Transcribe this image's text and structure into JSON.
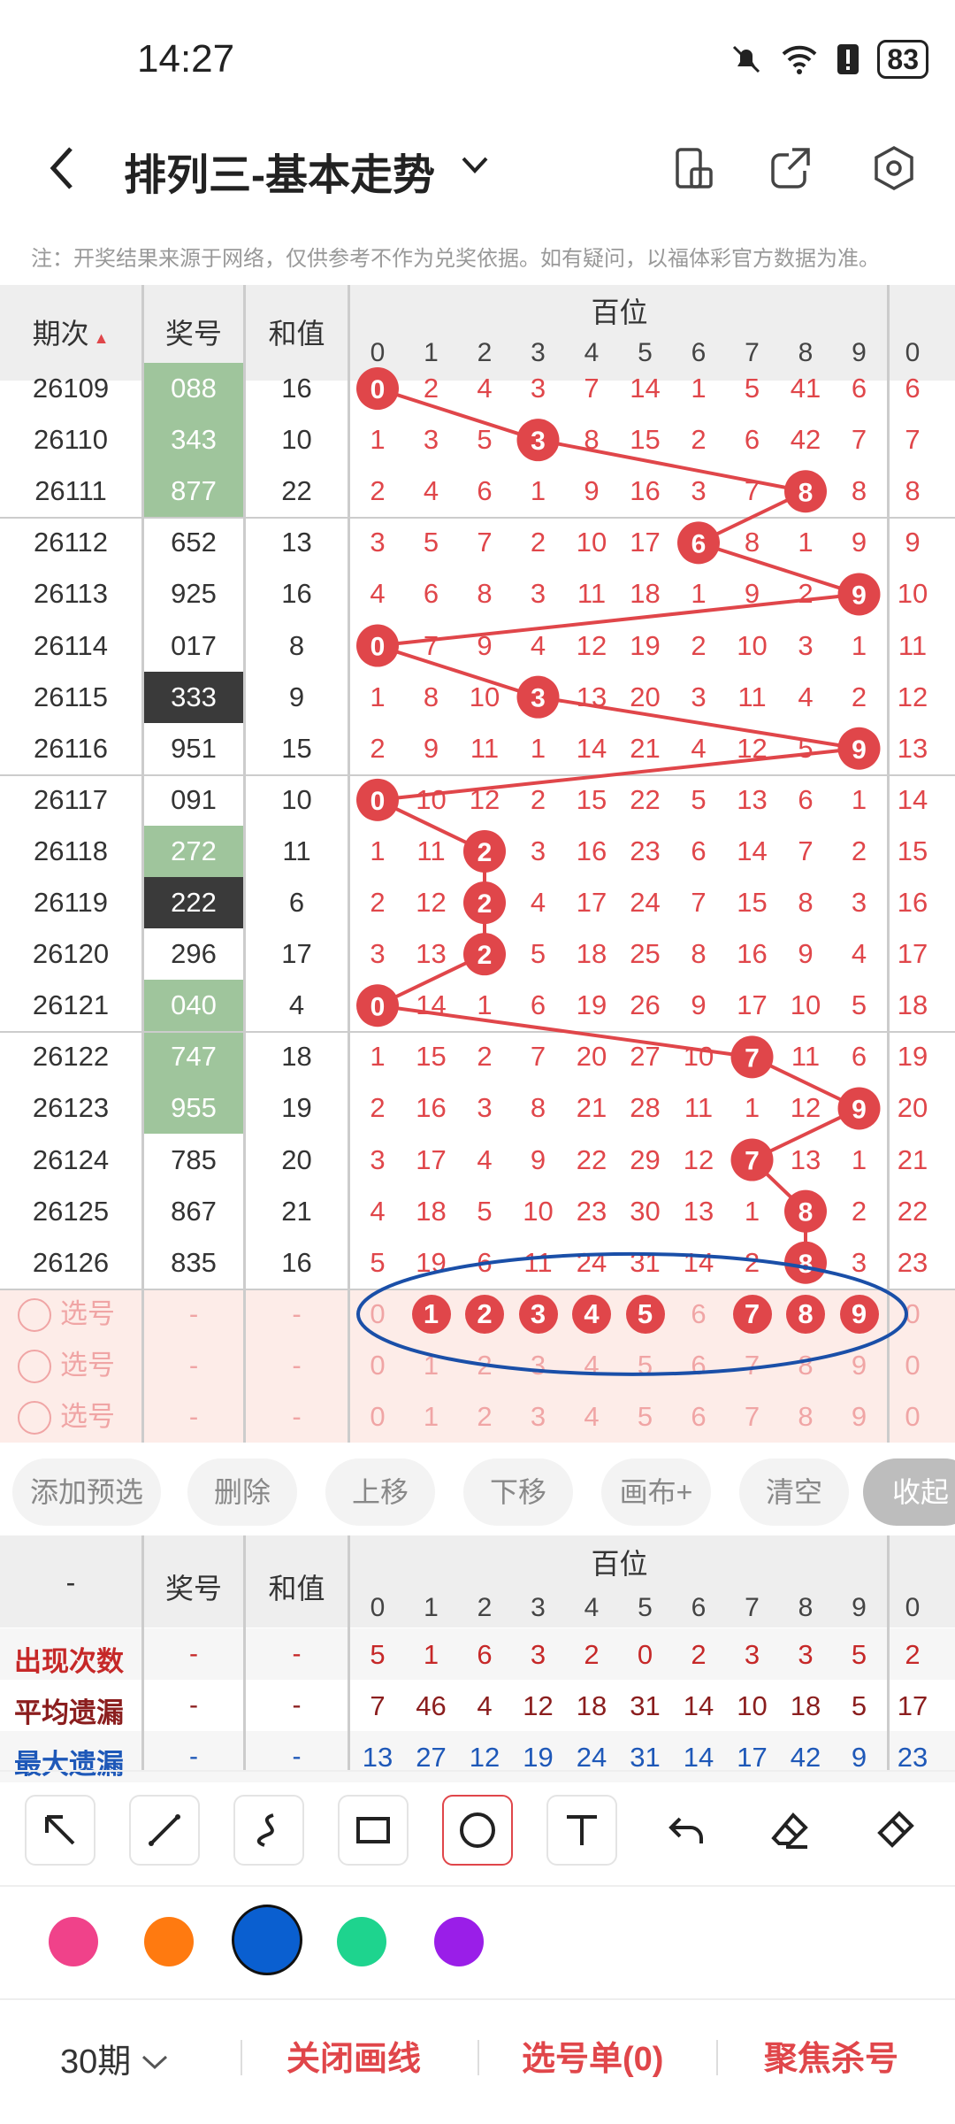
{
  "status": {
    "time": "14:27",
    "battery": "83"
  },
  "header": {
    "title": "排列三-基本走势"
  },
  "note": "注：开奖结果来源于网络，仅供参考不作为兑奖依据。如有疑问，以福体彩官方数据为准。",
  "table": {
    "col_issue": "期次",
    "col_award": "奖号",
    "col_sum": "和值",
    "col_hundreds": "百位",
    "digits": [
      "0",
      "1",
      "2",
      "3",
      "4",
      "5",
      "6",
      "7",
      "8",
      "9",
      "0"
    ],
    "rows": [
      {
        "issue": "26109",
        "award": "088",
        "sum": "16",
        "cells": [
          "0",
          "2",
          "4",
          "3",
          "7",
          "14",
          "1",
          "5",
          "41",
          "6",
          "6"
        ]
      },
      {
        "issue": "26110",
        "award": "343",
        "sum": "10",
        "cells": [
          "1",
          "3",
          "5",
          "3",
          "8",
          "15",
          "2",
          "6",
          "42",
          "7",
          "7"
        ]
      },
      {
        "issue": "26111",
        "award": "877",
        "sum": "22",
        "cells": [
          "2",
          "4",
          "6",
          "1",
          "9",
          "16",
          "3",
          "7",
          "8",
          "8",
          "8"
        ]
      },
      {
        "issue": "26112",
        "award": "652",
        "sum": "13",
        "cells": [
          "3",
          "5",
          "7",
          "2",
          "10",
          "17",
          "6",
          "8",
          "1",
          "9",
          "9"
        ]
      },
      {
        "issue": "26113",
        "award": "925",
        "sum": "16",
        "cells": [
          "4",
          "6",
          "8",
          "3",
          "11",
          "18",
          "1",
          "9",
          "2",
          "9",
          "10"
        ]
      },
      {
        "issue": "26114",
        "award": "017",
        "sum": "8",
        "cells": [
          "0",
          "7",
          "9",
          "4",
          "12",
          "19",
          "2",
          "10",
          "3",
          "1",
          "11"
        ]
      },
      {
        "issue": "26115",
        "award": "333",
        "sum": "9",
        "cells": [
          "1",
          "8",
          "10",
          "3",
          "13",
          "20",
          "3",
          "11",
          "4",
          "2",
          "12"
        ]
      },
      {
        "issue": "26116",
        "award": "951",
        "sum": "15",
        "cells": [
          "2",
          "9",
          "11",
          "1",
          "14",
          "21",
          "4",
          "12",
          "5",
          "9",
          "13"
        ]
      },
      {
        "issue": "26117",
        "award": "091",
        "sum": "10",
        "cells": [
          "0",
          "10",
          "12",
          "2",
          "15",
          "22",
          "5",
          "13",
          "6",
          "1",
          "14"
        ]
      },
      {
        "issue": "26118",
        "award": "272",
        "sum": "11",
        "cells": [
          "1",
          "11",
          "2",
          "3",
          "16",
          "23",
          "6",
          "14",
          "7",
          "2",
          "15"
        ]
      },
      {
        "issue": "26119",
        "award": "222",
        "sum": "6",
        "cells": [
          "2",
          "12",
          "2",
          "4",
          "17",
          "24",
          "7",
          "15",
          "8",
          "3",
          "16"
        ]
      },
      {
        "issue": "26120",
        "award": "296",
        "sum": "17",
        "cells": [
          "3",
          "13",
          "2",
          "5",
          "18",
          "25",
          "8",
          "16",
          "9",
          "4",
          "17"
        ]
      },
      {
        "issue": "26121",
        "award": "040",
        "sum": "4",
        "cells": [
          "0",
          "14",
          "1",
          "6",
          "19",
          "26",
          "9",
          "17",
          "10",
          "5",
          "18"
        ]
      },
      {
        "issue": "26122",
        "award": "747",
        "sum": "18",
        "cells": [
          "1",
          "15",
          "2",
          "7",
          "20",
          "27",
          "10",
          "7",
          "11",
          "6",
          "19"
        ]
      },
      {
        "issue": "26123",
        "award": "955",
        "sum": "19",
        "cells": [
          "2",
          "16",
          "3",
          "8",
          "21",
          "28",
          "11",
          "1",
          "12",
          "9",
          "20"
        ]
      },
      {
        "issue": "26124",
        "award": "785",
        "sum": "20",
        "cells": [
          "3",
          "17",
          "4",
          "9",
          "22",
          "29",
          "12",
          "7",
          "13",
          "1",
          "21"
        ]
      },
      {
        "issue": "26125",
        "award": "867",
        "sum": "21",
        "cells": [
          "4",
          "18",
          "5",
          "10",
          "23",
          "30",
          "13",
          "1",
          "8",
          "2",
          "22"
        ]
      },
      {
        "issue": "26126",
        "award": "835",
        "sum": "16",
        "cells": [
          "5",
          "19",
          "6",
          "11",
          "24",
          "31",
          "14",
          "2",
          "8",
          "3",
          "23"
        ]
      }
    ],
    "pick_label": "选号",
    "dash": "-",
    "pick_rows": [
      [
        "0",
        "1",
        "2",
        "3",
        "4",
        "5",
        "6",
        "7",
        "8",
        "9",
        "0"
      ],
      [
        "0",
        "1",
        "2",
        "3",
        "4",
        "5",
        "6",
        "7",
        "8",
        "9",
        "0"
      ],
      [
        "0",
        "1",
        "2",
        "3",
        "4",
        "5",
        "6",
        "7",
        "8",
        "9",
        "0"
      ]
    ]
  },
  "actions": {
    "add": "添加预选",
    "del": "删除",
    "up": "上移",
    "down": "下移",
    "canvas": "画布+",
    "clear": "清空",
    "collapse": "收起"
  },
  "stats": {
    "col_dash": "-",
    "col_award": "奖号",
    "col_sum": "和值",
    "col_hundreds": "百位",
    "appear_label": "出现次数",
    "avg_label": "平均遗漏",
    "max_label": "最大遗漏",
    "appear": [
      "5",
      "1",
      "6",
      "3",
      "2",
      "0",
      "2",
      "3",
      "3",
      "5",
      "2"
    ],
    "avg": [
      "7",
      "46",
      "4",
      "12",
      "18",
      "31",
      "14",
      "10",
      "18",
      "5",
      "17"
    ],
    "max": [
      "13",
      "27",
      "12",
      "19",
      "24",
      "31",
      "14",
      "17",
      "42",
      "9",
      "23"
    ]
  },
  "colors": {
    "red": "#e0464a",
    "blue": "#1a4fa8",
    "green": "#9fc59c",
    "pink": "#f0428a",
    "orange": "#ff7a10",
    "selblue": "#0a5fd0",
    "teal": "#1ed48e",
    "purple": "#9a1ee8"
  },
  "bottom": {
    "period": "30期",
    "close_lines": "关闭画线",
    "pick_list": "选号单(0)",
    "focus": "聚焦杀号"
  }
}
